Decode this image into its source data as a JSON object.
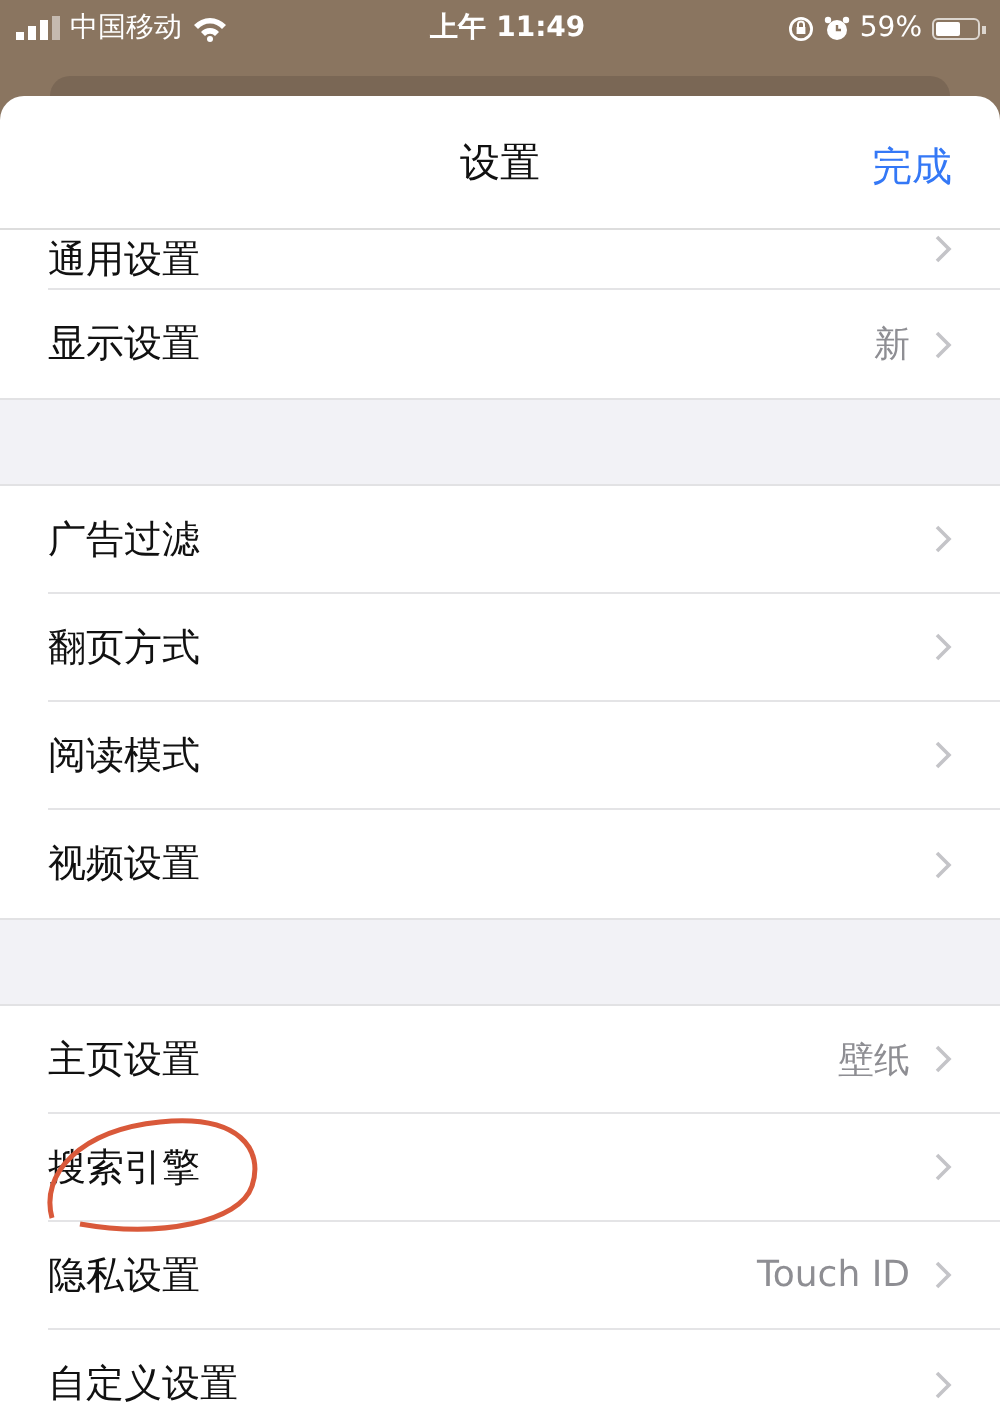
{
  "status_bar": {
    "carrier": "中国移动",
    "time": "上午 11:49",
    "battery_percent": "59%",
    "battery": {
      "level": 0.59
    }
  },
  "sheet": {
    "title": "设置",
    "done_button": "完成"
  },
  "sections": [
    {
      "items": [
        {
          "label": "通用设置",
          "circled": false
        },
        {
          "label": "显示设置",
          "value": "新",
          "circled": false
        }
      ]
    },
    {
      "items": [
        {
          "label": "广告过滤",
          "circled": false
        },
        {
          "label": "翻页方式",
          "circled": false
        },
        {
          "label": "阅读模式",
          "circled": false
        },
        {
          "label": "视频设置",
          "circled": false
        }
      ]
    },
    {
      "items": [
        {
          "label": "主页设置",
          "value": "壁纸",
          "circled": false
        },
        {
          "label": "搜索引擎",
          "circled": true
        },
        {
          "label": "隐私设置",
          "value": "Touch ID",
          "circled": false
        },
        {
          "label": "自定义设置",
          "circled": false
        }
      ]
    }
  ]
}
